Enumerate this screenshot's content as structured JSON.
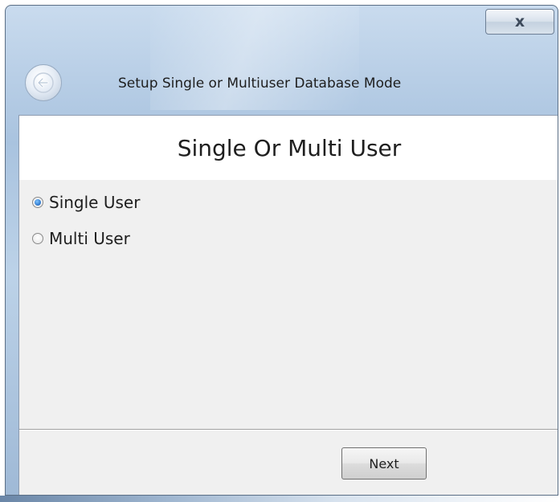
{
  "window": {
    "title": "Setup Single or Multiuser Database Mode",
    "close_symbol": "x",
    "close_icon": "close-icon",
    "back_icon": "back-arrow-icon"
  },
  "page": {
    "title": "Single Or Multi User"
  },
  "options": [
    {
      "label": "Single User",
      "selected": true
    },
    {
      "label": "Multi User",
      "selected": false
    }
  ],
  "footer": {
    "next_label": "Next"
  },
  "colors": {
    "radio_selected": "#2a73c9",
    "header_background": "#ffffff",
    "content_background": "#f0f0f0"
  }
}
